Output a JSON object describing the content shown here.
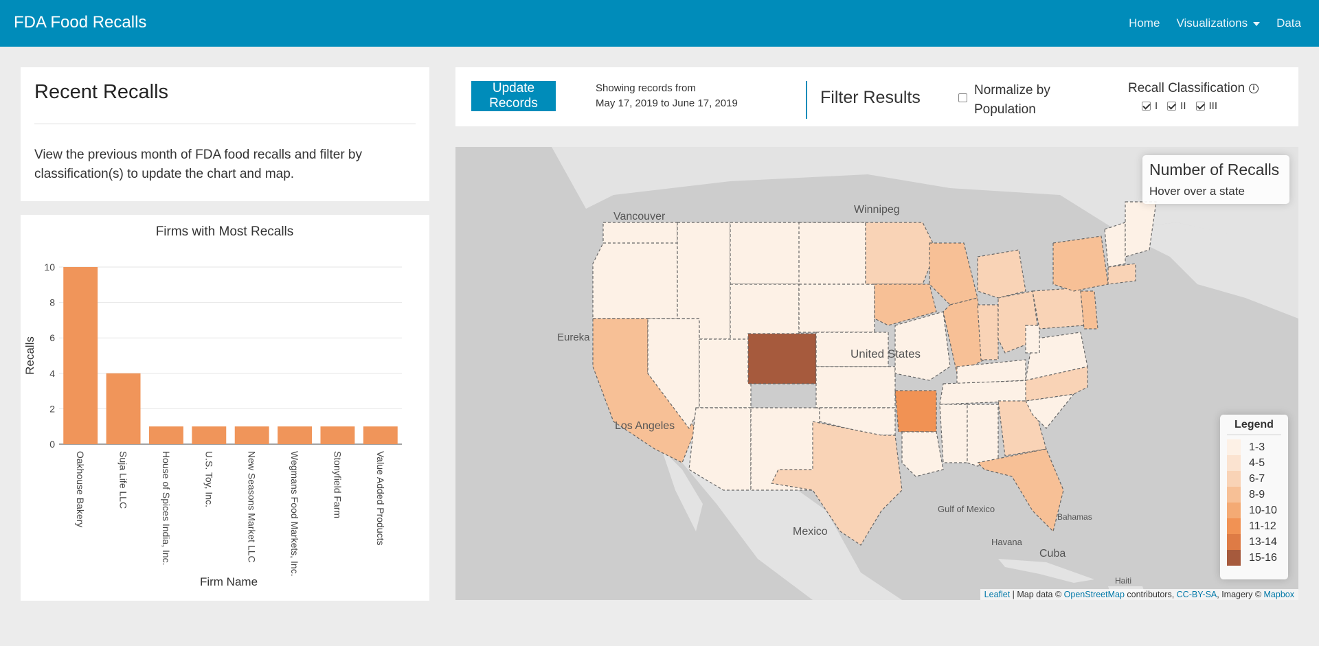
{
  "navbar": {
    "brand": "FDA Food Recalls",
    "links": [
      "Home",
      "Visualizations",
      "Data"
    ]
  },
  "recent": {
    "title": "Recent Recalls",
    "description": "View the previous month of FDA food recalls and filter by classification(s) to update the chart and map."
  },
  "controls": {
    "update_button": "Update Records",
    "showing_line1": "Showing records from",
    "showing_line2": "May 17, 2019 to June 17, 2019",
    "filter_title": "Filter Results",
    "normalize_label": "Normalize by Population",
    "normalize_checked": false,
    "classification_title": "Recall Classification",
    "classifications": [
      {
        "label": "I",
        "checked": true
      },
      {
        "label": "II",
        "checked": true
      },
      {
        "label": "III",
        "checked": true
      }
    ]
  },
  "chart_data": {
    "type": "bar",
    "title": "Firms with Most Recalls",
    "xlabel": "Firm Name",
    "ylabel": "Recalls",
    "categories": [
      "Oakhouse Bakery",
      "Suja Life LLC",
      "House of Spices India, Inc.",
      "U.S. Toy, Inc.",
      "New Seasons Market LLC",
      "Wegmans Food Markets, Inc.",
      "Stonyfield Farm",
      "Value Added Products"
    ],
    "values": [
      10,
      4,
      1,
      1,
      1,
      1,
      1,
      1
    ],
    "yticks": [
      0,
      2,
      4,
      6,
      8,
      10
    ],
    "ylim": [
      0,
      10
    ],
    "grid": true,
    "color": "#f0955a"
  },
  "map": {
    "info_title": "Number of Recalls",
    "info_hint": "Hover over a state",
    "legend_title": "Legend",
    "legend": [
      {
        "label": "1-3",
        "color": "#fdf1e6"
      },
      {
        "label": "4-5",
        "color": "#fbe3d0"
      },
      {
        "label": "6-7",
        "color": "#f9d3b6"
      },
      {
        "label": "8-9",
        "color": "#f7c096"
      },
      {
        "label": "10-10",
        "color": "#f4aa74"
      },
      {
        "label": "11-12",
        "color": "#f19254"
      },
      {
        "label": "13-14",
        "color": "#de7b45"
      },
      {
        "label": "15-16",
        "color": "#a65a3d"
      }
    ],
    "places": [
      "Vancouver",
      "Winnipeg",
      "Eureka",
      "Los Angeles",
      "United States",
      "Mexico",
      "Gulf of Mexico",
      "Havana",
      "Cuba",
      "Bahamas",
      "Haiti"
    ],
    "attribution": {
      "leaflet": "Leaflet",
      "mid": " | Map data © ",
      "osm": "OpenStreetMap",
      "contrib": " contributors, ",
      "cc": "CC-BY-SA",
      "imagery": ", Imagery © ",
      "mapbox": "Mapbox"
    }
  }
}
